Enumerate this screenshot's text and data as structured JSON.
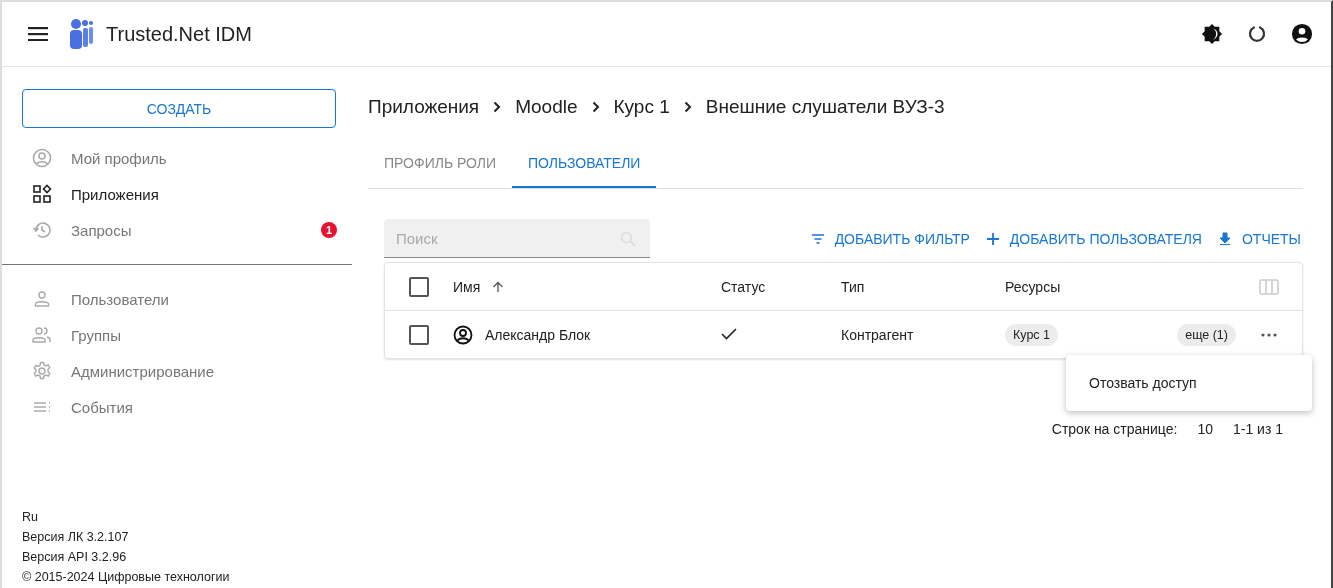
{
  "header": {
    "title": "Trusted.Net IDM"
  },
  "sidebar": {
    "create_button": "СОЗДАТЬ",
    "items": [
      {
        "label": "Мой профиль",
        "selected": false
      },
      {
        "label": "Приложения",
        "selected": true
      },
      {
        "label": "Запросы",
        "selected": false,
        "badge": "1"
      }
    ],
    "admin_items": [
      {
        "label": "Пользователи",
        "selected": false
      },
      {
        "label": "Группы",
        "selected": false
      },
      {
        "label": "Администрирование",
        "selected": false
      },
      {
        "label": "События",
        "selected": false
      }
    ],
    "footer": [
      "Ru",
      "Версия ЛК 3.2.107",
      "Версия API 3.2.96",
      "© 2015-2024 Цифровые технологии"
    ]
  },
  "breadcrumb": [
    "Приложения",
    "Moodle",
    "Курс 1",
    "Внешние слушатели ВУЗ-3"
  ],
  "tabs": [
    {
      "label": "ПРОФИЛЬ РОЛИ",
      "selected": false
    },
    {
      "label": "ПОЛЬЗОВАТЕЛИ",
      "selected": true
    }
  ],
  "search": {
    "placeholder": "Поиск"
  },
  "actions": [
    {
      "label": "ДОБАВИТЬ ФИЛЬТР"
    },
    {
      "label": "ДОБАВИТЬ ПОЛЬЗОВАТЕЛЯ"
    },
    {
      "label": "ОТЧЕТЫ"
    }
  ],
  "table": {
    "columns": [
      "Имя",
      "Статус",
      "Тип",
      "Ресурсы"
    ],
    "all_checked": false,
    "rows": [
      {
        "checked": false,
        "name": "Александр Блок",
        "active": true,
        "type": "Контрагент",
        "resources": [
          "Курс 1"
        ],
        "more": "еще (1)"
      }
    ]
  },
  "context_menu": {
    "items": [
      "Отозвать доступ"
    ]
  },
  "pagination": {
    "rows_label": "Строк на странице:",
    "rows_value": "10",
    "range": "1-1 из 1"
  }
}
